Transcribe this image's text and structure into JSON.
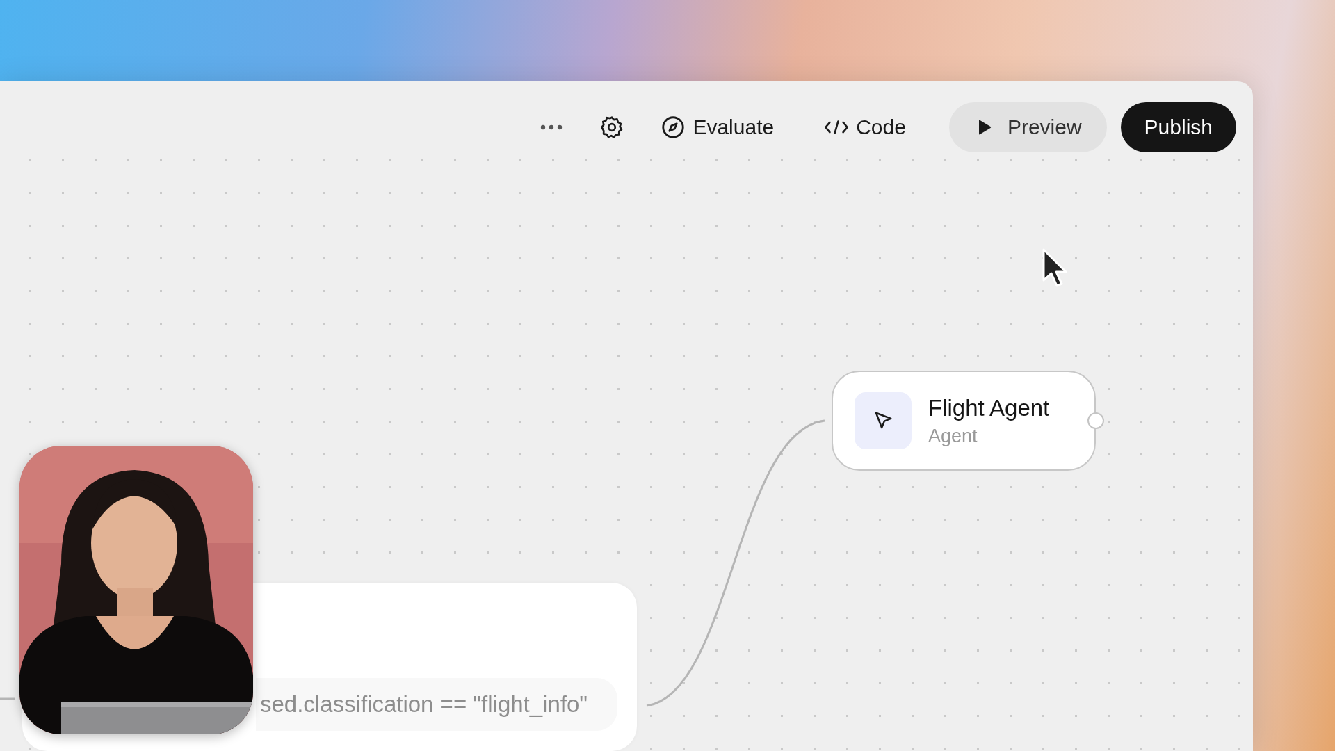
{
  "toolbar": {
    "evaluate": "Evaluate",
    "code": "Code",
    "preview": "Preview",
    "publish": "Publish"
  },
  "canvas": {
    "nodes": [
      {
        "title": "Flight Agent",
        "subtitle": "Agent"
      }
    ],
    "condition_card": {
      "expression": "sed.classification == \"flight_info\""
    }
  }
}
